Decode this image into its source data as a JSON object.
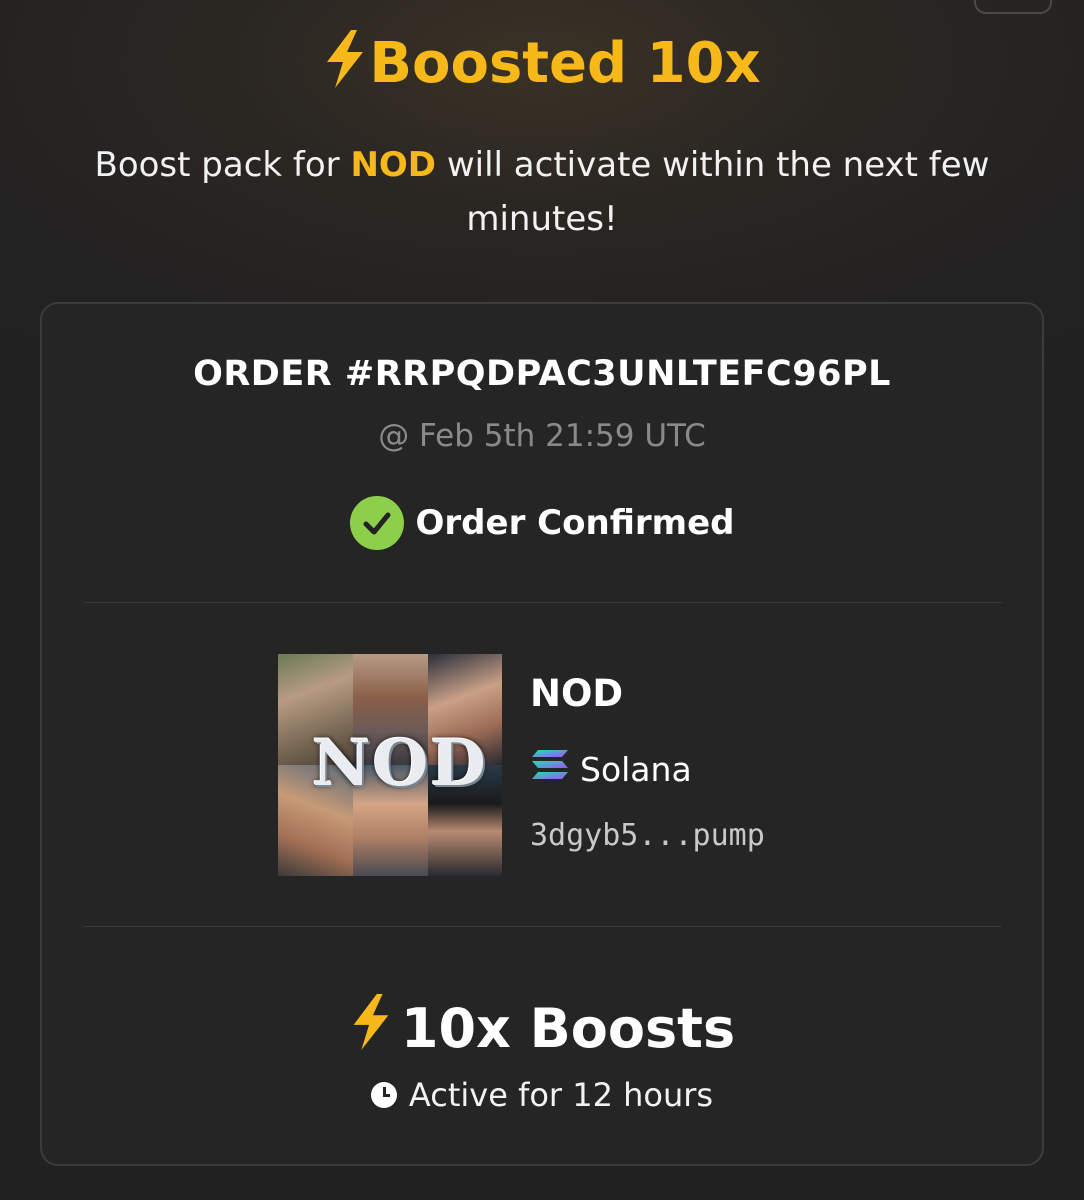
{
  "header": {
    "title": "Boosted 10x",
    "title_icon": "lightning-bolt-icon",
    "subtitle_before": "Boost pack for ",
    "subtitle_token": "NOD",
    "subtitle_after": " will activate within the next few minutes!"
  },
  "order": {
    "id_label": "ORDER #RRPQDPAC3UNLTEFC96PL",
    "timestamp": "@ Feb 5th 21:59 UTC",
    "status": "Order Confirmed",
    "status_icon": "check-circle-icon"
  },
  "token": {
    "name": "NOD",
    "image_text": "NOD",
    "chain": "Solana",
    "chain_icon": "solana-icon",
    "address": "3dgyb5...pump"
  },
  "boost": {
    "amount_label": "10x Boosts",
    "duration": "Active for 12 hours",
    "duration_icon": "clock-icon"
  },
  "colors": {
    "accent": "#f7b91a",
    "success": "#8ccf4a",
    "card_bg": "#252525",
    "muted": "#8a8a8a"
  }
}
